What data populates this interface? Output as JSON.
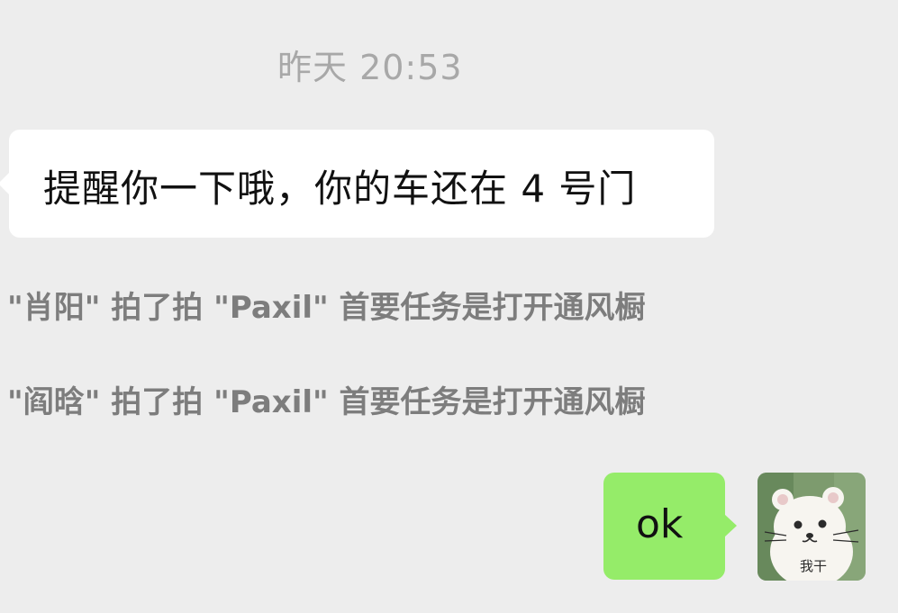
{
  "chat": {
    "timestamp": "昨天 20:53",
    "incoming_message": "提醒你一下哦，你的车还在 4 号门",
    "system_messages": [
      "\"肖阳\" 拍了拍 \"Paxil\" 首要任务是打开通风橱",
      "\"阎晗\" 拍了拍 \"Paxil\" 首要任务是打开通风橱"
    ],
    "outgoing_message": "ok",
    "avatar": {
      "icon": "cat-avatar-icon",
      "caption": "我干"
    }
  },
  "colors": {
    "background": "#ededed",
    "incoming_bubble": "#ffffff",
    "outgoing_bubble": "#95ec69",
    "timestamp_text": "#a8a8a8",
    "system_text": "#7d7d7d"
  }
}
